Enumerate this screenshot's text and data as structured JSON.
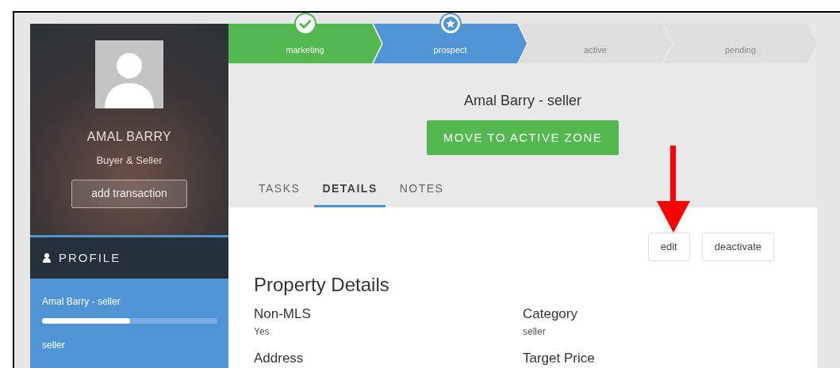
{
  "contact": {
    "name": "AMAL BARRY",
    "role": "Buyer & Seller",
    "add_button": "add transaction"
  },
  "sidebar": {
    "section": "PROFILE",
    "items": [
      {
        "title": "Amal Barry - seller",
        "level": 0.5,
        "subtitle": "seller",
        "selected": true
      }
    ]
  },
  "steps": [
    {
      "label": "marketing",
      "kind": "done"
    },
    {
      "label": "prospect",
      "kind": "current"
    },
    {
      "label": "active",
      "kind": "todo"
    },
    {
      "label": "pending",
      "kind": "todo"
    }
  ],
  "header": {
    "title": "Amal Barry - seller",
    "action": "MOVE TO ACTIVE ZONE"
  },
  "tabs": [
    {
      "label": "TASKS",
      "selected": false
    },
    {
      "label": "DETAILS",
      "selected": true
    },
    {
      "label": "NOTES",
      "selected": false
    }
  ],
  "actions": [
    "edit",
    "deactivate"
  ],
  "details": {
    "title": "Property Details",
    "fields": [
      {
        "label": "Non-MLS",
        "value": "Yes"
      },
      {
        "label": "Category",
        "value": "seller"
      },
      {
        "label": "Address"
      },
      {
        "label": "Target Price"
      }
    ]
  }
}
